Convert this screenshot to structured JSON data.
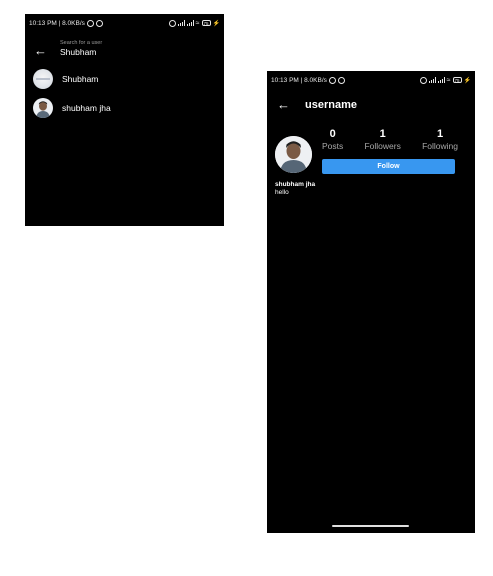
{
  "search_screen": {
    "status": {
      "time_speed": "10:13 PM | 8.0KB/s",
      "battery": "75"
    },
    "search": {
      "hint": "Search for a user",
      "value": "Shubham"
    },
    "results": [
      {
        "name": "Shubham"
      },
      {
        "name": "shubham jha"
      }
    ]
  },
  "profile_screen": {
    "status": {
      "time_speed": "10:13 PM | 8.0KB/s",
      "battery": "75"
    },
    "header": {
      "title": "username"
    },
    "stats": {
      "posts": {
        "value": "0",
        "label": "Posts"
      },
      "followers": {
        "value": "1",
        "label": "Followers"
      },
      "following": {
        "value": "1",
        "label": "Following"
      }
    },
    "follow_label": "Follow",
    "name": "shubham jha",
    "bio": "hello",
    "colors": {
      "accent": "#3897f0",
      "background": "#000000"
    }
  }
}
